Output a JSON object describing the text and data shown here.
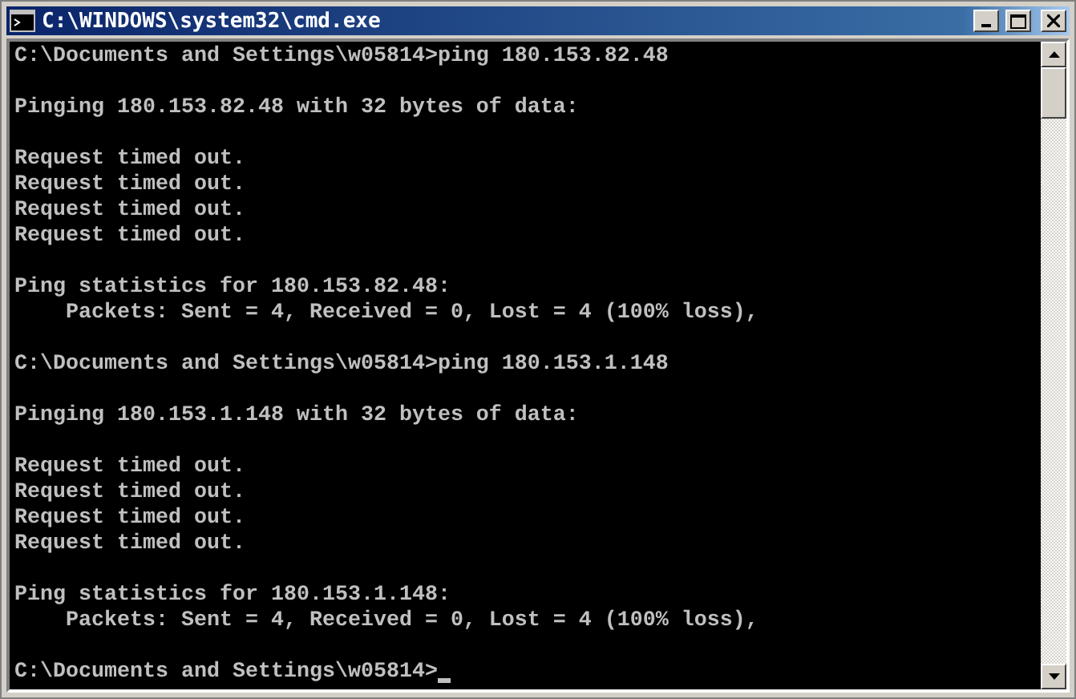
{
  "window": {
    "title": "C:\\WINDOWS\\system32\\cmd.exe"
  },
  "console": {
    "lines": [
      {
        "kind": "text",
        "text": "C:\\Documents and Settings\\w05814>ping 180.153.82.48"
      },
      {
        "kind": "blank"
      },
      {
        "kind": "text",
        "text": "Pinging 180.153.82.48 with 32 bytes of data:"
      },
      {
        "kind": "blank"
      },
      {
        "kind": "text",
        "text": "Request timed out."
      },
      {
        "kind": "text",
        "text": "Request timed out."
      },
      {
        "kind": "text",
        "text": "Request timed out."
      },
      {
        "kind": "text",
        "text": "Request timed out."
      },
      {
        "kind": "blank"
      },
      {
        "kind": "text",
        "text": "Ping statistics for 180.153.82.48:"
      },
      {
        "kind": "text",
        "text": "    Packets: Sent = 4, Received = 0, Lost = 4 (100% loss),"
      },
      {
        "kind": "blank"
      },
      {
        "kind": "text",
        "text": "C:\\Documents and Settings\\w05814>ping 180.153.1.148"
      },
      {
        "kind": "blank"
      },
      {
        "kind": "text",
        "text": "Pinging 180.153.1.148 with 32 bytes of data:"
      },
      {
        "kind": "blank"
      },
      {
        "kind": "text",
        "text": "Request timed out."
      },
      {
        "kind": "text",
        "text": "Request timed out."
      },
      {
        "kind": "text",
        "text": "Request timed out."
      },
      {
        "kind": "text",
        "text": "Request timed out."
      },
      {
        "kind": "blank"
      },
      {
        "kind": "text",
        "text": "Ping statistics for 180.153.1.148:"
      },
      {
        "kind": "text",
        "text": "    Packets: Sent = 4, Received = 0, Lost = 4 (100% loss),"
      },
      {
        "kind": "blank"
      },
      {
        "kind": "prompt",
        "text": "C:\\Documents and Settings\\w05814>",
        "cursor": true
      }
    ]
  }
}
